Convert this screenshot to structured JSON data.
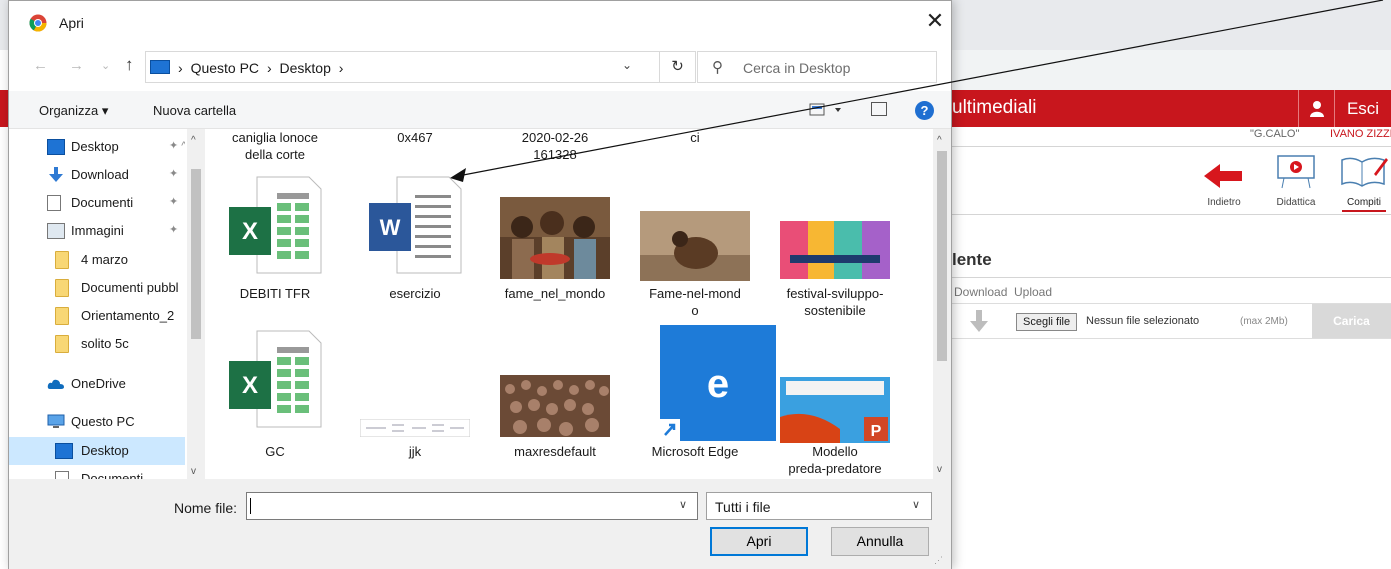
{
  "dialog": {
    "title": "Apri",
    "close_glyph": "✕",
    "nav": {
      "back": "←",
      "forward": "→",
      "recent": "⌄",
      "up": "↑",
      "breadcrumb": [
        "Questo PC",
        "Desktop"
      ],
      "separator": "›",
      "refresh": "↻",
      "search_placeholder": "Cerca in Desktop"
    },
    "toolbar": {
      "organize": "Organizza ▾",
      "new_folder": "Nuova cartella",
      "help": "?"
    },
    "sidebar": [
      {
        "label": "Desktop",
        "icon": "desktop-icon",
        "pinned": true
      },
      {
        "label": "Download",
        "icon": "download-icon",
        "pinned": true
      },
      {
        "label": "Documenti",
        "icon": "documents-icon",
        "pinned": true
      },
      {
        "label": "Immagini",
        "icon": "pictures-icon",
        "pinned": true
      },
      {
        "label": "4 marzo",
        "icon": "folder-icon",
        "pinned": false
      },
      {
        "label": "Documenti pubbl",
        "icon": "folder-icon",
        "pinned": false
      },
      {
        "label": "Orientamento_2",
        "icon": "folder-icon",
        "pinned": false
      },
      {
        "label": "solito 5c",
        "icon": "folder-icon",
        "pinned": false
      },
      {
        "label": "OneDrive",
        "icon": "onedrive-icon",
        "pinned": false
      },
      {
        "label": "Questo PC",
        "icon": "this-pc-icon",
        "pinned": false
      },
      {
        "label": "Desktop",
        "icon": "desktop-icon",
        "pinned": false,
        "selected": true
      },
      {
        "label": "Documenti",
        "icon": "documents-icon",
        "pinned": false
      }
    ],
    "pin_glyph": "📌",
    "cut_row": [
      {
        "line1": "caniglia lonoce",
        "line2": "della corte"
      },
      {
        "line1": "0x467",
        "line2": ""
      },
      {
        "line1": "2020-02-26",
        "line2": "161328"
      },
      {
        "line1": "ci",
        "line2": ""
      }
    ],
    "files": [
      {
        "name": "DEBITI TFR",
        "type": "excel",
        "glyph": "X"
      },
      {
        "name": "esercizio",
        "type": "word",
        "glyph": "W"
      },
      {
        "name": "fame_nel_mondo",
        "type": "photo"
      },
      {
        "name": "Fame-nel-mond\no",
        "type": "photo"
      },
      {
        "name": "festival-sviluppo-\nsostenibile",
        "type": "photo"
      },
      {
        "name": "GC",
        "type": "excel",
        "glyph": "X"
      },
      {
        "name": "jjk",
        "type": "formula"
      },
      {
        "name": "maxresdefault",
        "type": "photo"
      },
      {
        "name": "Microsoft Edge",
        "type": "shortcut",
        "glyph": "e"
      },
      {
        "name": "Modello\npreda-predatore",
        "type": "ppt",
        "glyph": "P"
      }
    ],
    "bottom": {
      "filename_label": "Nome file:",
      "filename_value": "",
      "filetype": "Tutti i file",
      "open": "Apri",
      "cancel": "Annulla"
    }
  },
  "background": {
    "title": "ultimediali",
    "exit": "Esci",
    "school": "\"G.CALO\"",
    "user": "IVANO ZIZZI",
    "tools": [
      {
        "label": "Indietro",
        "icon": "back-arrow-icon"
      },
      {
        "label": "Didattica",
        "icon": "presentation-icon"
      },
      {
        "label": "Compiti",
        "icon": "homework-icon",
        "active": true
      }
    ],
    "section_title": "lente",
    "columns": [
      "Download",
      "Upload"
    ],
    "choose_file": "Scegli file",
    "no_file": "Nessun file selezionato",
    "max_size": "(max 2Mb)",
    "upload_btn": "Carica"
  },
  "colors": {
    "accent_red": "#c8161d",
    "selection": "#cce8ff",
    "excel_green": "#1d7145",
    "word_blue": "#2b579a",
    "edge_blue": "#1e7bd8"
  }
}
